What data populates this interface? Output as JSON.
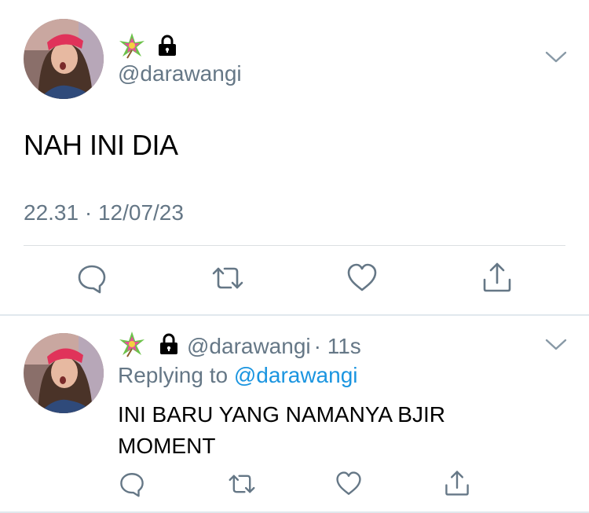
{
  "main_tweet": {
    "avatar_icon": "user-avatar-photo",
    "badge_icons": [
      "pinwheel-star-emoji-icon",
      "lock-icon"
    ],
    "handle": "@darawangi",
    "text": "NAH INI DIA",
    "timestamp": "22.31 · 12/07/23",
    "menu_icon": "chevron-down-icon",
    "actions": [
      "reply-icon",
      "retweet-icon",
      "like-icon",
      "share-icon"
    ]
  },
  "reply_tweet": {
    "avatar_icon": "user-avatar-photo",
    "badge_icons": [
      "pinwheel-star-emoji-icon",
      "lock-icon"
    ],
    "handle": "@darawangi",
    "time_ago": "· 11s",
    "replying_to_label": "Replying to",
    "replying_to_mention": "@darawangi",
    "text": "INI BARU YANG NAMANYA BJIR MOMENT",
    "menu_icon": "chevron-down-icon",
    "actions": [
      "reply-icon",
      "retweet-icon",
      "like-icon",
      "share-icon"
    ]
  },
  "colors": {
    "secondary_text": "#657786",
    "link_blue": "#1b95e0",
    "icon_gray": "#657786",
    "divider": "#e1e8ed"
  }
}
